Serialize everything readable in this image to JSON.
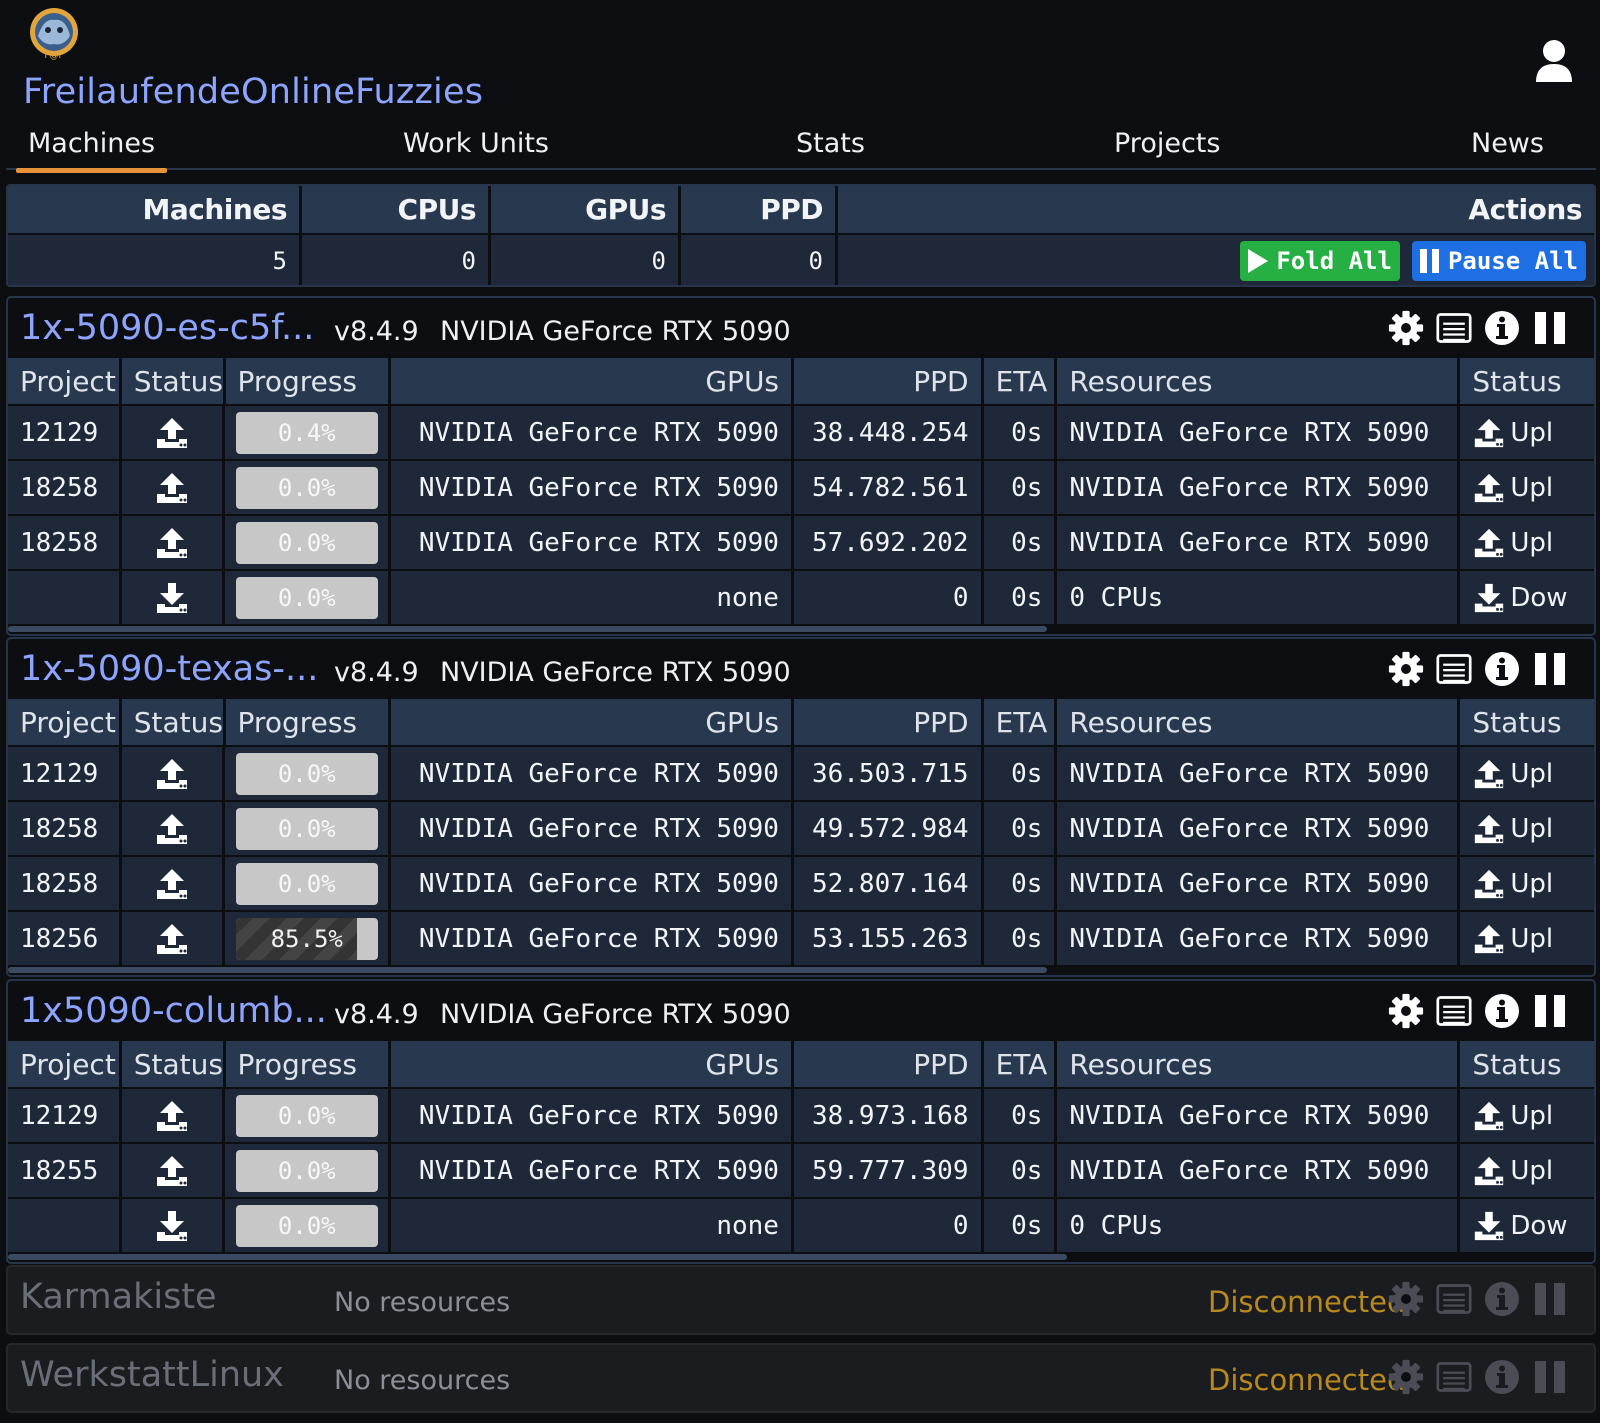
{
  "app": {
    "title": "FreilaufendeOnlineFuzzies",
    "logo_text": "F@F",
    "nav": [
      {
        "label": "Machines",
        "active": true
      },
      {
        "label": "Work Units"
      },
      {
        "label": "Stats"
      },
      {
        "label": "Projects"
      },
      {
        "label": "News"
      }
    ],
    "accent": "#8ea5ff",
    "nav_indicator_color": "#e8933a"
  },
  "summary": {
    "headers": {
      "machines": "Machines",
      "cpus": "CPUs",
      "gpus": "GPUs",
      "ppd": "PPD",
      "actions": "Actions"
    },
    "values": {
      "machines": "5",
      "cpus": "0",
      "gpus": "0",
      "ppd": "0"
    },
    "fold_all": "Fold All",
    "pause_all": "Pause All"
  },
  "columns": {
    "project": "Project",
    "status": "Status",
    "progress": "Progress",
    "gpus": "GPUs",
    "ppd": "PPD",
    "eta": "ETA",
    "resources": "Resources",
    "status2": "Status"
  },
  "machines": [
    {
      "name": "1x-5090-es-c5f...",
      "version": "v8.4.9",
      "gpu": "NVIDIA GeForce RTX 5090",
      "units": [
        {
          "project": "12129",
          "state": "upload",
          "progress": "0.4%",
          "progress_value": 0.4,
          "gpus": "NVIDIA GeForce RTX 5090",
          "ppd": "38.448.254",
          "eta": "0s",
          "resources": "NVIDIA GeForce RTX 5090",
          "status2": "Upl"
        },
        {
          "project": "18258",
          "state": "upload",
          "progress": "0.0%",
          "progress_value": 0.0,
          "gpus": "NVIDIA GeForce RTX 5090",
          "ppd": "54.782.561",
          "eta": "0s",
          "resources": "NVIDIA GeForce RTX 5090",
          "status2": "Upl"
        },
        {
          "project": "18258",
          "state": "upload",
          "progress": "0.0%",
          "progress_value": 0.0,
          "gpus": "NVIDIA GeForce RTX 5090",
          "ppd": "57.692.202",
          "eta": "0s",
          "resources": "NVIDIA GeForce RTX 5090",
          "status2": "Upl"
        },
        {
          "project": "",
          "state": "download",
          "progress": "0.0%",
          "progress_value": 0.0,
          "gpus": "none",
          "ppd": "0",
          "eta": "0s",
          "resources": "0 CPUs",
          "status2": "Dow"
        }
      ],
      "scroll_thumb_fraction": 0.655
    },
    {
      "name": "1x-5090-texas-...",
      "version": "v8.4.9",
      "gpu": "NVIDIA GeForce RTX 5090",
      "units": [
        {
          "project": "12129",
          "state": "upload",
          "progress": "0.0%",
          "progress_value": 0.0,
          "gpus": "NVIDIA GeForce RTX 5090",
          "ppd": "36.503.715",
          "eta": "0s",
          "resources": "NVIDIA GeForce RTX 5090",
          "status2": "Upl"
        },
        {
          "project": "18258",
          "state": "upload",
          "progress": "0.0%",
          "progress_value": 0.0,
          "gpus": "NVIDIA GeForce RTX 5090",
          "ppd": "49.572.984",
          "eta": "0s",
          "resources": "NVIDIA GeForce RTX 5090",
          "status2": "Upl"
        },
        {
          "project": "18258",
          "state": "upload",
          "progress": "0.0%",
          "progress_value": 0.0,
          "gpus": "NVIDIA GeForce RTX 5090",
          "ppd": "52.807.164",
          "eta": "0s",
          "resources": "NVIDIA GeForce RTX 5090",
          "status2": "Upl"
        },
        {
          "project": "18256",
          "state": "upload",
          "progress": "85.5%",
          "progress_value": 85.5,
          "gpus": "NVIDIA GeForce RTX 5090",
          "ppd": "53.155.263",
          "eta": "0s",
          "resources": "NVIDIA GeForce RTX 5090",
          "status2": "Upl"
        }
      ],
      "scroll_thumb_fraction": 0.655
    },
    {
      "name": "1x5090-columb...",
      "version": "v8.4.9",
      "gpu": "NVIDIA GeForce RTX 5090",
      "units": [
        {
          "project": "12129",
          "state": "upload",
          "progress": "0.0%",
          "progress_value": 0.0,
          "gpus": "NVIDIA GeForce RTX 5090",
          "ppd": "38.973.168",
          "eta": "0s",
          "resources": "NVIDIA GeForce RTX 5090",
          "status2": "Upl"
        },
        {
          "project": "18255",
          "state": "upload",
          "progress": "0.0%",
          "progress_value": 0.0,
          "gpus": "NVIDIA GeForce RTX 5090",
          "ppd": "59.777.309",
          "eta": "0s",
          "resources": "NVIDIA GeForce RTX 5090",
          "status2": "Upl"
        },
        {
          "project": "",
          "state": "download",
          "progress": "0.0%",
          "progress_value": 0.0,
          "gpus": "none",
          "ppd": "0",
          "eta": "0s",
          "resources": "0 CPUs",
          "status2": "Dow"
        }
      ],
      "scroll_thumb_fraction": 0.668
    }
  ],
  "offline_machines": [
    {
      "name": "Karmakiste",
      "resources": "No resources",
      "status": "Disconnected"
    },
    {
      "name": "WerkstattLinux",
      "resources": "No resources",
      "status": "Disconnected"
    }
  ],
  "colors": {
    "disconnected": "#b88a1e",
    "upload_icon": "#ffffff"
  }
}
